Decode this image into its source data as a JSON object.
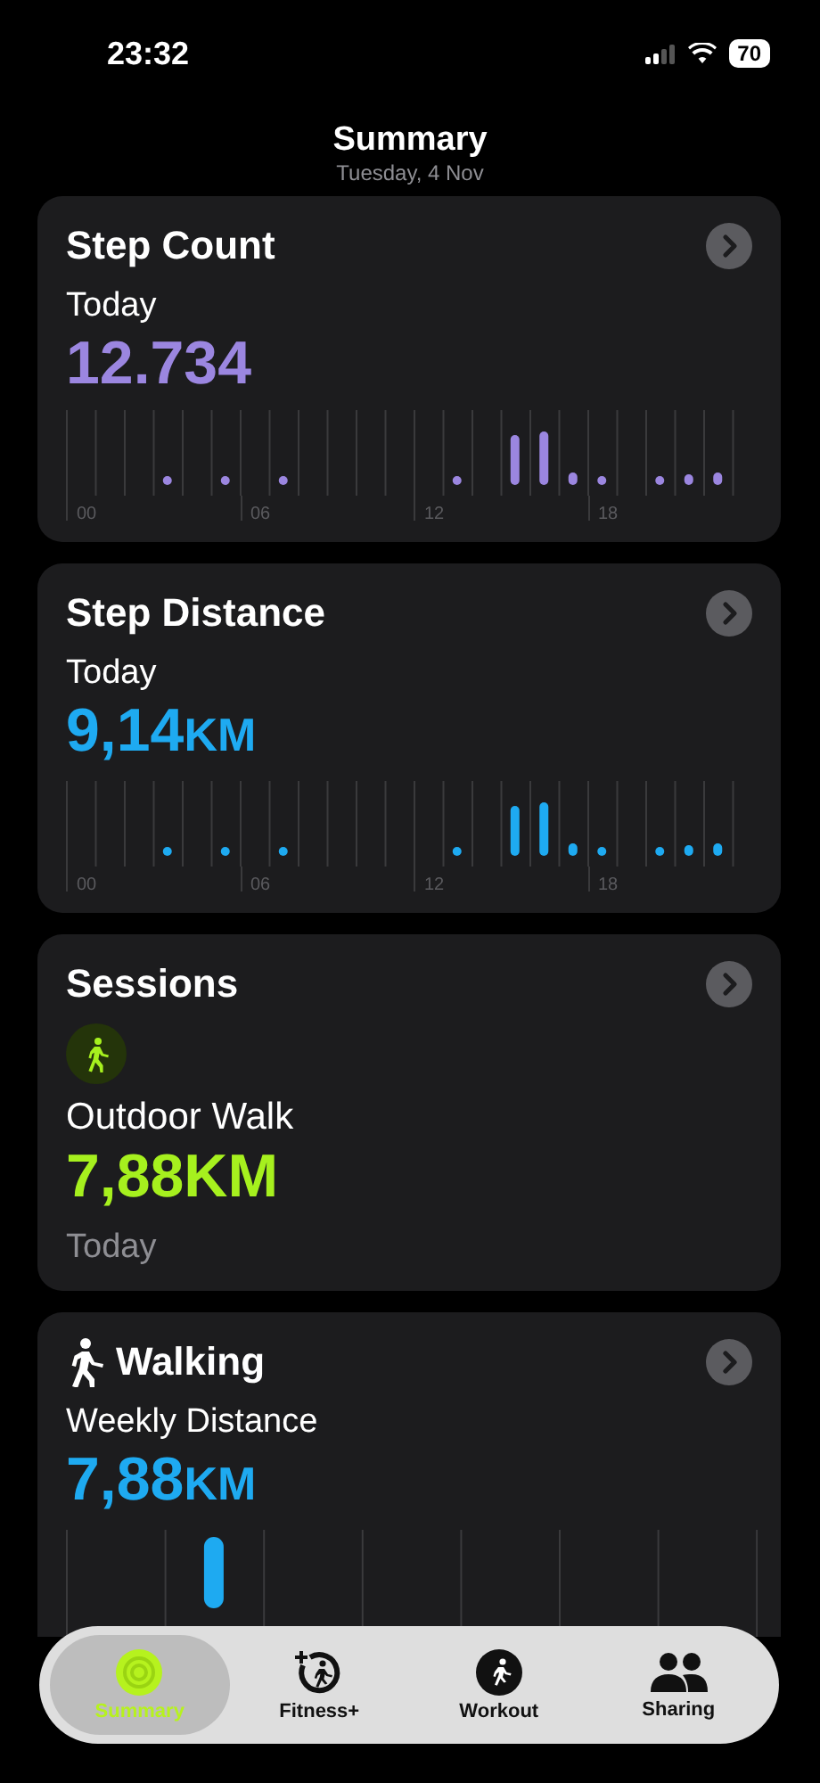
{
  "status_bar": {
    "time": "23:32",
    "battery": "70"
  },
  "header": {
    "title": "Summary",
    "date": "Tuesday, 4 Nov"
  },
  "cards": [
    {
      "kind": "hourly",
      "title": "Step Count",
      "subtitle": "Today",
      "value": "12.734",
      "color": "#9b86e0",
      "axis_labels": [
        "00",
        "06",
        "12",
        "18"
      ]
    },
    {
      "kind": "hourly",
      "title": "Step Distance",
      "subtitle": "Today",
      "value": "9,14",
      "unit": "KM",
      "color": "#1eaaf1",
      "axis_labels": [
        "00",
        "06",
        "12",
        "18"
      ]
    },
    {
      "kind": "session",
      "title": "Sessions",
      "activity": "Outdoor Walk",
      "value": "7,88KM",
      "when": "Today"
    },
    {
      "kind": "weekly",
      "title": "Walking",
      "subtitle": "Weekly Distance",
      "value": "7,88",
      "unit": "KM",
      "color": "#1eaaf1"
    }
  ],
  "tab_bar": [
    {
      "label": "Summary",
      "selected": true
    },
    {
      "label": "Fitness+",
      "selected": false
    },
    {
      "label": "Workout",
      "selected": false
    },
    {
      "label": "Sharing",
      "selected": false
    }
  ]
}
